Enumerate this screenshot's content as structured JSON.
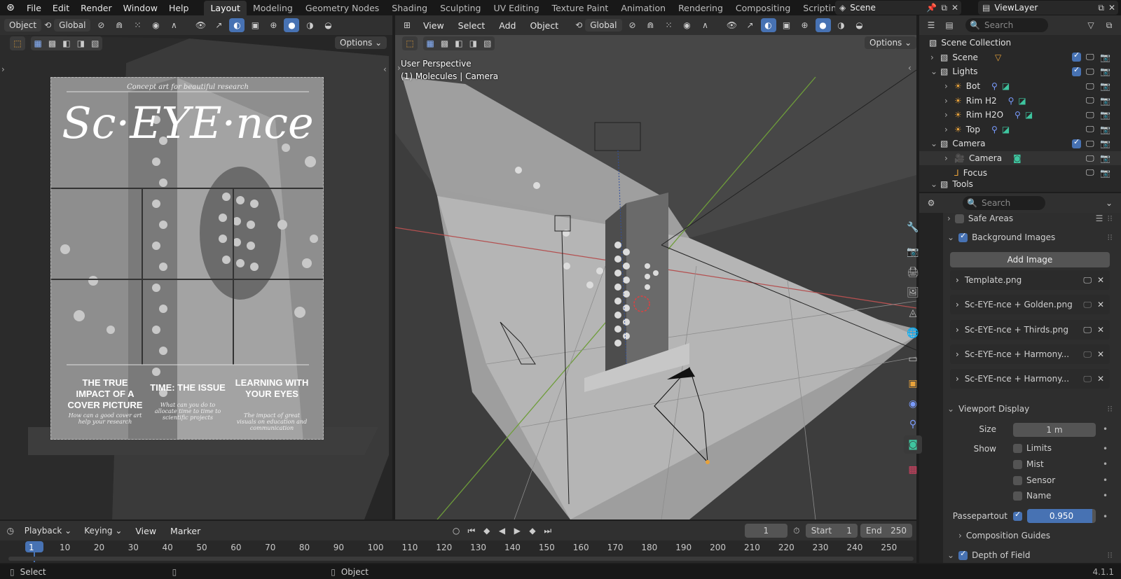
{
  "app": {
    "version": "4.1.1"
  },
  "menu": [
    "File",
    "Edit",
    "Render",
    "Window",
    "Help"
  ],
  "workspaces": [
    "Layout",
    "Modeling",
    "Geometry Nodes",
    "Shading",
    "Sculpting",
    "UV Editing",
    "Texture Paint",
    "Animation",
    "Rendering",
    "Compositing",
    "Scripting"
  ],
  "active_workspace": "Layout",
  "scene_name": "Scene",
  "view_layer": "ViewLayer",
  "left_view": {
    "mode": "Object",
    "orientation": "Global",
    "options": "Options",
    "cover": {
      "tagline": "Concept art for beautiful research",
      "title": "Sc·EYE·nce",
      "col1_head": "THE TRUE IMPACT OF A COVER PICTURE",
      "col1_body": "How can a good cover art help your research",
      "col2_head": "TIME: THE ISSUE",
      "col2_body": "What can you do to allocate time to time to scientific projects",
      "col3_head": "LEARNING WITH YOUR EYES",
      "col3_body": "The impact of great visuals on education and communication"
    }
  },
  "main_view": {
    "menu": [
      "View",
      "Select",
      "Add",
      "Object"
    ],
    "orientation": "Global",
    "options": "Options",
    "overlay_line1": "User Perspective",
    "overlay_line2": "(1) Molecules | Camera"
  },
  "outliner": {
    "search_placeholder": "Search",
    "root": "Scene Collection",
    "rows": [
      {
        "label": "Scene",
        "level": 1
      },
      {
        "label": "Lights",
        "level": 1
      },
      {
        "label": "Bot",
        "level": 2
      },
      {
        "label": "Rim H2",
        "level": 2
      },
      {
        "label": "Rim H2O",
        "level": 2
      },
      {
        "label": "Top",
        "level": 2
      },
      {
        "label": "Camera",
        "level": 1
      },
      {
        "label": "Camera",
        "level": 2
      },
      {
        "label": "Focus",
        "level": 2
      },
      {
        "label": "Tools",
        "level": 1
      }
    ]
  },
  "properties": {
    "search_placeholder": "Search",
    "safe_areas": "Safe Areas",
    "background_images": "Background Images",
    "add_image": "Add Image",
    "images": [
      "Template.png",
      "Sc-EYE-nce + Golden.png",
      "Sc-EYE-nce + Thirds.png",
      "Sc-EYE-nce + Harmony...",
      "Sc-EYE-nce + Harmony..."
    ],
    "viewport_display": "Viewport Display",
    "size_label": "Size",
    "size_value": "1 m",
    "show_label": "Show",
    "show_limits": "Limits",
    "show_mist": "Mist",
    "show_sensor": "Sensor",
    "show_name": "Name",
    "passepartout_label": "Passepartout",
    "passepartout_value": "0.950",
    "composition_guides": "Composition Guides",
    "depth_of_field": "Depth of Field"
  },
  "timeline": {
    "menu": [
      "Playback",
      "Keying",
      "View",
      "Marker"
    ],
    "current_frame": "1",
    "start_label": "Start",
    "start_value": "1",
    "end_label": "End",
    "end_value": "250",
    "ticks": [
      "1",
      "10",
      "20",
      "30",
      "40",
      "50",
      "60",
      "70",
      "80",
      "90",
      "100",
      "110",
      "120",
      "130",
      "140",
      "150",
      "160",
      "170",
      "180",
      "190",
      "200",
      "210",
      "220",
      "230",
      "240",
      "250"
    ]
  },
  "statusbar": {
    "left": "Select",
    "mid": "Object"
  }
}
